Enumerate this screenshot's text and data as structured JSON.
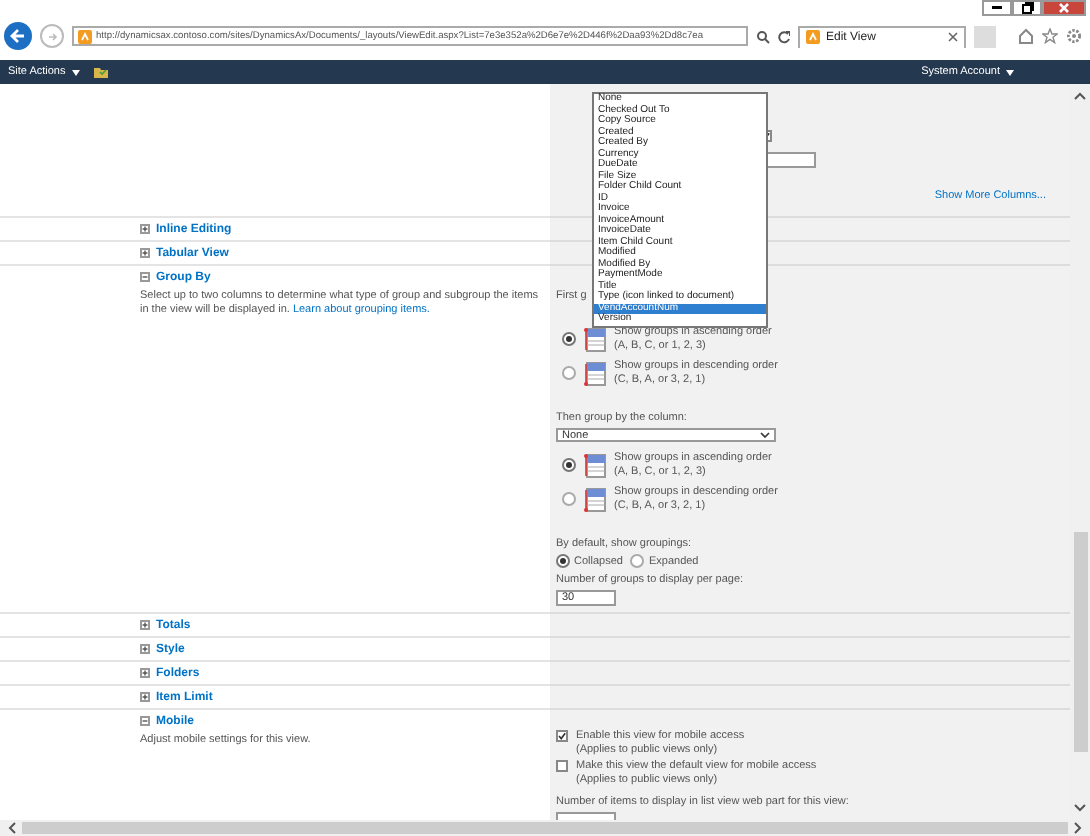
{
  "browser": {
    "url": "http://dynamicsax.contoso.com/sites/DynamicsAx/Documents/_layouts/ViewEdit.aspx?List=7e3e352a%2D6e7e%2D446f%2Daa93%2Dd8c7ea",
    "tab": "Edit View"
  },
  "nav": {
    "site_actions": "Site Actions",
    "account": "System Account"
  },
  "sections": [
    {
      "kind": "columns_tail",
      "settings": [
        {
          "kind": "checkbox",
          "checked": true
        },
        {
          "kind": "field"
        },
        {
          "kind": "link",
          "text": "Show More Columns..."
        }
      ]
    },
    {
      "kind": "section",
      "title": "Inline Editing",
      "expanded": false
    },
    {
      "kind": "section",
      "title": "Tabular View",
      "expanded": false
    },
    {
      "kind": "section",
      "title": "Group By",
      "expanded": true,
      "description": "Select up to two columns to determine what type of group and subgroup the items in the view will be displayed in.",
      "link": "Learn about grouping items.",
      "settings": [
        {
          "kind": "label",
          "text": "First g"
        },
        {
          "kind": "sort_ascending",
          "selected": true,
          "line1": "Show groups in ascending order",
          "line2": "(A, B, C, or 1, 2, 3)"
        },
        {
          "kind": "sort_descending",
          "selected": false,
          "line1": "Show groups in descending order",
          "line2": "(C, B, A, or 3, 2, 1)"
        },
        {
          "kind": "label",
          "text": "Then group by the column:"
        },
        {
          "kind": "select",
          "value": "None"
        },
        {
          "kind": "sort_ascending",
          "selected": true,
          "line1": "Show groups in ascending order",
          "line2": "(A, B, C, or 1, 2, 3)"
        },
        {
          "kind": "sort_descending",
          "selected": false,
          "line1": "Show groups in descending order",
          "line2": "(C, B, A, or 3, 2, 1)"
        },
        {
          "kind": "label",
          "text": "By default, show groupings:"
        },
        {
          "kind": "radio_pair",
          "options": [
            {
              "label": "Collapsed",
              "selected": true
            },
            {
              "label": "Expanded",
              "selected": false
            }
          ]
        },
        {
          "kind": "label",
          "text": "Number of groups to display per page:"
        },
        {
          "kind": "field",
          "value": "30"
        }
      ]
    },
    {
      "kind": "section",
      "title": "Totals",
      "expanded": false
    },
    {
      "kind": "section",
      "title": "Style",
      "expanded": false
    },
    {
      "kind": "section",
      "title": "Folders",
      "expanded": false
    },
    {
      "kind": "section",
      "title": "Item Limit",
      "expanded": false
    },
    {
      "kind": "section",
      "title": "Mobile",
      "expanded": true,
      "description": "Adjust mobile settings for this view.",
      "settings": [
        {
          "kind": "checkbox",
          "checked": true,
          "text": "Enable this view for mobile access",
          "note": "(Applies to public views only)"
        },
        {
          "kind": "checkbox",
          "checked": false,
          "text": "Make this view the default view for mobile access",
          "note": "(Applies to public views only)"
        },
        {
          "kind": "label",
          "text": "Number of items to display in list view web part for this view:"
        },
        {
          "kind": "field"
        }
      ]
    }
  ],
  "column_dropdown": {
    "options": [
      {
        "label": "None",
        "selected": false
      },
      {
        "label": "Checked Out To",
        "selected": false
      },
      {
        "label": "Copy Source",
        "selected": false
      },
      {
        "label": "Created",
        "selected": false
      },
      {
        "label": "Created By",
        "selected": false
      },
      {
        "label": "Currency",
        "selected": false
      },
      {
        "label": "DueDate",
        "selected": false
      },
      {
        "label": "File Size",
        "selected": false
      },
      {
        "label": "Folder Child Count",
        "selected": false
      },
      {
        "label": "ID",
        "selected": false
      },
      {
        "label": "Invoice",
        "selected": false
      },
      {
        "label": "InvoiceAmount",
        "selected": false
      },
      {
        "label": "InvoiceDate",
        "selected": false
      },
      {
        "label": "Item Child Count",
        "selected": false
      },
      {
        "label": "Modified",
        "selected": false
      },
      {
        "label": "Modified By",
        "selected": false
      },
      {
        "label": "PaymentMode",
        "selected": false
      },
      {
        "label": "Title",
        "selected": false
      },
      {
        "label": "Type (icon linked to document)",
        "selected": false
      },
      {
        "label": "VendAccountNum",
        "selected": true
      },
      {
        "label": "Version",
        "selected": false
      }
    ]
  }
}
